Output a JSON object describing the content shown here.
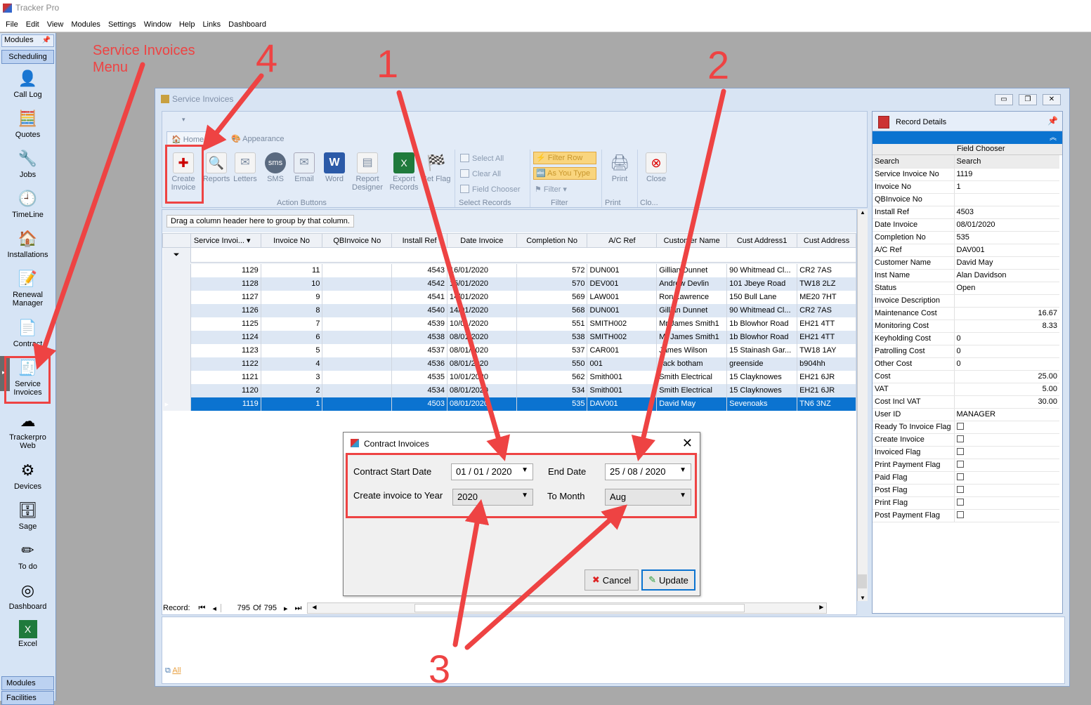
{
  "app": {
    "title": "Tracker Pro",
    "menu": [
      "File",
      "Edit",
      "View",
      "Modules",
      "Settings",
      "Window",
      "Help",
      "Links",
      "Dashboard"
    ]
  },
  "sidebar": {
    "header": "Modules",
    "group": "Scheduling",
    "items": [
      {
        "label": "Call Log",
        "icon": "call-log-icon"
      },
      {
        "label": "Quotes",
        "icon": "calculator-icon"
      },
      {
        "label": "Jobs",
        "icon": "wrench-icon"
      },
      {
        "label": "TimeLine",
        "icon": "clock-icon"
      },
      {
        "label": "Installations",
        "icon": "house-icon"
      },
      {
        "label": "Renewal Manager",
        "icon": "document-pen-icon"
      },
      {
        "label": "Contract",
        "icon": "contract-icon"
      },
      {
        "label": "Service Invoices",
        "icon": "invoice-icon"
      },
      {
        "label": "Trackerpro Web",
        "icon": "cloud-icon"
      },
      {
        "label": "Devices",
        "icon": "devices-icon"
      },
      {
        "label": "Sage",
        "icon": "database-icon"
      },
      {
        "label": "To do",
        "icon": "pencil-icon"
      },
      {
        "label": "Dashboard",
        "icon": "gauge-icon"
      },
      {
        "label": "Excel",
        "icon": "excel-icon"
      }
    ],
    "footer": [
      "Modules",
      "Facilities"
    ]
  },
  "window": {
    "title": "Service Invoices"
  },
  "ribbon": {
    "tabs": [
      "Home",
      "Appearance"
    ],
    "buttons": [
      "Create Invoice",
      "Reports",
      "Letters",
      "SMS",
      "Email",
      "Word",
      "Report Designer",
      "Export Records",
      "Set Flag"
    ],
    "select": [
      "Select All",
      "Clear All",
      "Field Chooser"
    ],
    "filter": [
      "Filter Row",
      "As You Type",
      "Filter"
    ],
    "print": [
      "Print"
    ],
    "close": [
      "Close"
    ],
    "groups": [
      "Action Buttons",
      "Select Records",
      "Filter",
      "Print",
      "Clo..."
    ]
  },
  "grid": {
    "group_hint": "Drag a column header here to group by that column.",
    "columns": [
      "Service Invoi...",
      "Invoice No",
      "QBInvoice No",
      "Install Ref",
      "Date Invoice",
      "Completion No",
      "A/C Ref",
      "Customer Name",
      "Cust Address1",
      "Cust Address"
    ],
    "rows": [
      [
        "1129",
        "11",
        "",
        "4543",
        "16/01/2020",
        "572",
        "DUN001",
        "Gillian Dunnet",
        "90 Whitmead Cl...",
        "CR2 7AS"
      ],
      [
        "1128",
        "10",
        "",
        "4542",
        "15/01/2020",
        "570",
        "DEV001",
        "Andrew Devlin",
        "101 Jbeye Road",
        "TW18 2LZ"
      ],
      [
        "1127",
        "9",
        "",
        "4541",
        "14/01/2020",
        "569",
        "LAW001",
        "Ron Lawrence",
        "150 Bull Lane",
        "ME20 7HT"
      ],
      [
        "1126",
        "8",
        "",
        "4540",
        "14/01/2020",
        "568",
        "DUN001",
        "Gillian Dunnet",
        "90 Whitmead Cl...",
        "CR2 7AS"
      ],
      [
        "1125",
        "7",
        "",
        "4539",
        "10/01/2020",
        "551",
        "SMITH002",
        "Mr James Smith1",
        "1b Blowhor Road",
        "EH21 4TT"
      ],
      [
        "1124",
        "6",
        "",
        "4538",
        "08/01/2020",
        "538",
        "SMITH002",
        "Mr James Smith1",
        "1b Blowhor Road",
        "EH21 4TT"
      ],
      [
        "1123",
        "5",
        "",
        "4537",
        "08/01/2020",
        "537",
        "CAR001",
        "James Wilson",
        "15 Stainash Gar...",
        "TW18 1AY"
      ],
      [
        "1122",
        "4",
        "",
        "4536",
        "08/01/2020",
        "550",
        "001",
        "Jack botham",
        "greenside",
        "b904hh"
      ],
      [
        "1121",
        "3",
        "",
        "4535",
        "10/01/2020",
        "562",
        "Smith001",
        "Smith Electrical",
        "15 Clayknowes",
        "EH21 6JR"
      ],
      [
        "1120",
        "2",
        "",
        "4534",
        "08/01/2020",
        "534",
        "Smith001",
        "Smith Electrical",
        "15 Clayknowes",
        "EH21 6JR"
      ],
      [
        "1119",
        "1",
        "",
        "4503",
        "08/01/2020",
        "535",
        "DAV001",
        "David May",
        "Sevenoaks",
        "TN6 3NZ"
      ]
    ],
    "nav": {
      "label": "Record:",
      "current": "795",
      "of": "Of",
      "total": "795"
    }
  },
  "details": {
    "title": "Record Details",
    "field_chooser": "Field Chooser",
    "fields": [
      [
        "Search",
        "Search"
      ],
      [
        "Service Invoice No",
        "1119"
      ],
      [
        "Invoice No",
        "1"
      ],
      [
        "QBInvoice No",
        ""
      ],
      [
        "Install Ref",
        "4503"
      ],
      [
        "Date Invoice",
        "08/01/2020"
      ],
      [
        "Completion No",
        "535"
      ],
      [
        "A/C Ref",
        "DAV001"
      ],
      [
        "Customer Name",
        "David May"
      ],
      [
        "Inst Name",
        "Alan Davidson"
      ],
      [
        "Status",
        "Open"
      ],
      [
        "Invoice Description",
        ""
      ],
      [
        "Maintenance Cost",
        "16.67"
      ],
      [
        "Monitoring Cost",
        "8.33"
      ],
      [
        "Keyholding Cost",
        "0"
      ],
      [
        "Patrolling Cost",
        "0"
      ],
      [
        "Other Cost",
        "0"
      ],
      [
        "Cost",
        "25.00"
      ],
      [
        "VAT",
        "5.00"
      ],
      [
        "Cost Incl VAT",
        "30.00"
      ],
      [
        "User ID",
        "MANAGER"
      ]
    ],
    "flags": [
      "Ready To Invoice Flag",
      "Create Invoice",
      "Invoiced Flag",
      "Print Payment Flag",
      "Paid Flag",
      "Post Flag",
      "Print Flag",
      "Post Payment Flag"
    ]
  },
  "bottom": {
    "tab": "All"
  },
  "dialog": {
    "title": "Contract Invoices",
    "start_label": "Contract Start Date",
    "start_value": "01 / 01 / 2020",
    "end_label": "End Date",
    "end_value": "25 / 08 / 2020",
    "year_label": "Create invoice to Year",
    "year_value": "2020",
    "month_label": "To Month",
    "month_value": "Aug",
    "cancel": "Cancel",
    "update": "Update"
  },
  "annotations": {
    "menu_note": "Service Invoices Menu",
    "n1": "1",
    "n2": "2",
    "n3": "3",
    "n4": "4",
    "color": "#ee4343"
  }
}
